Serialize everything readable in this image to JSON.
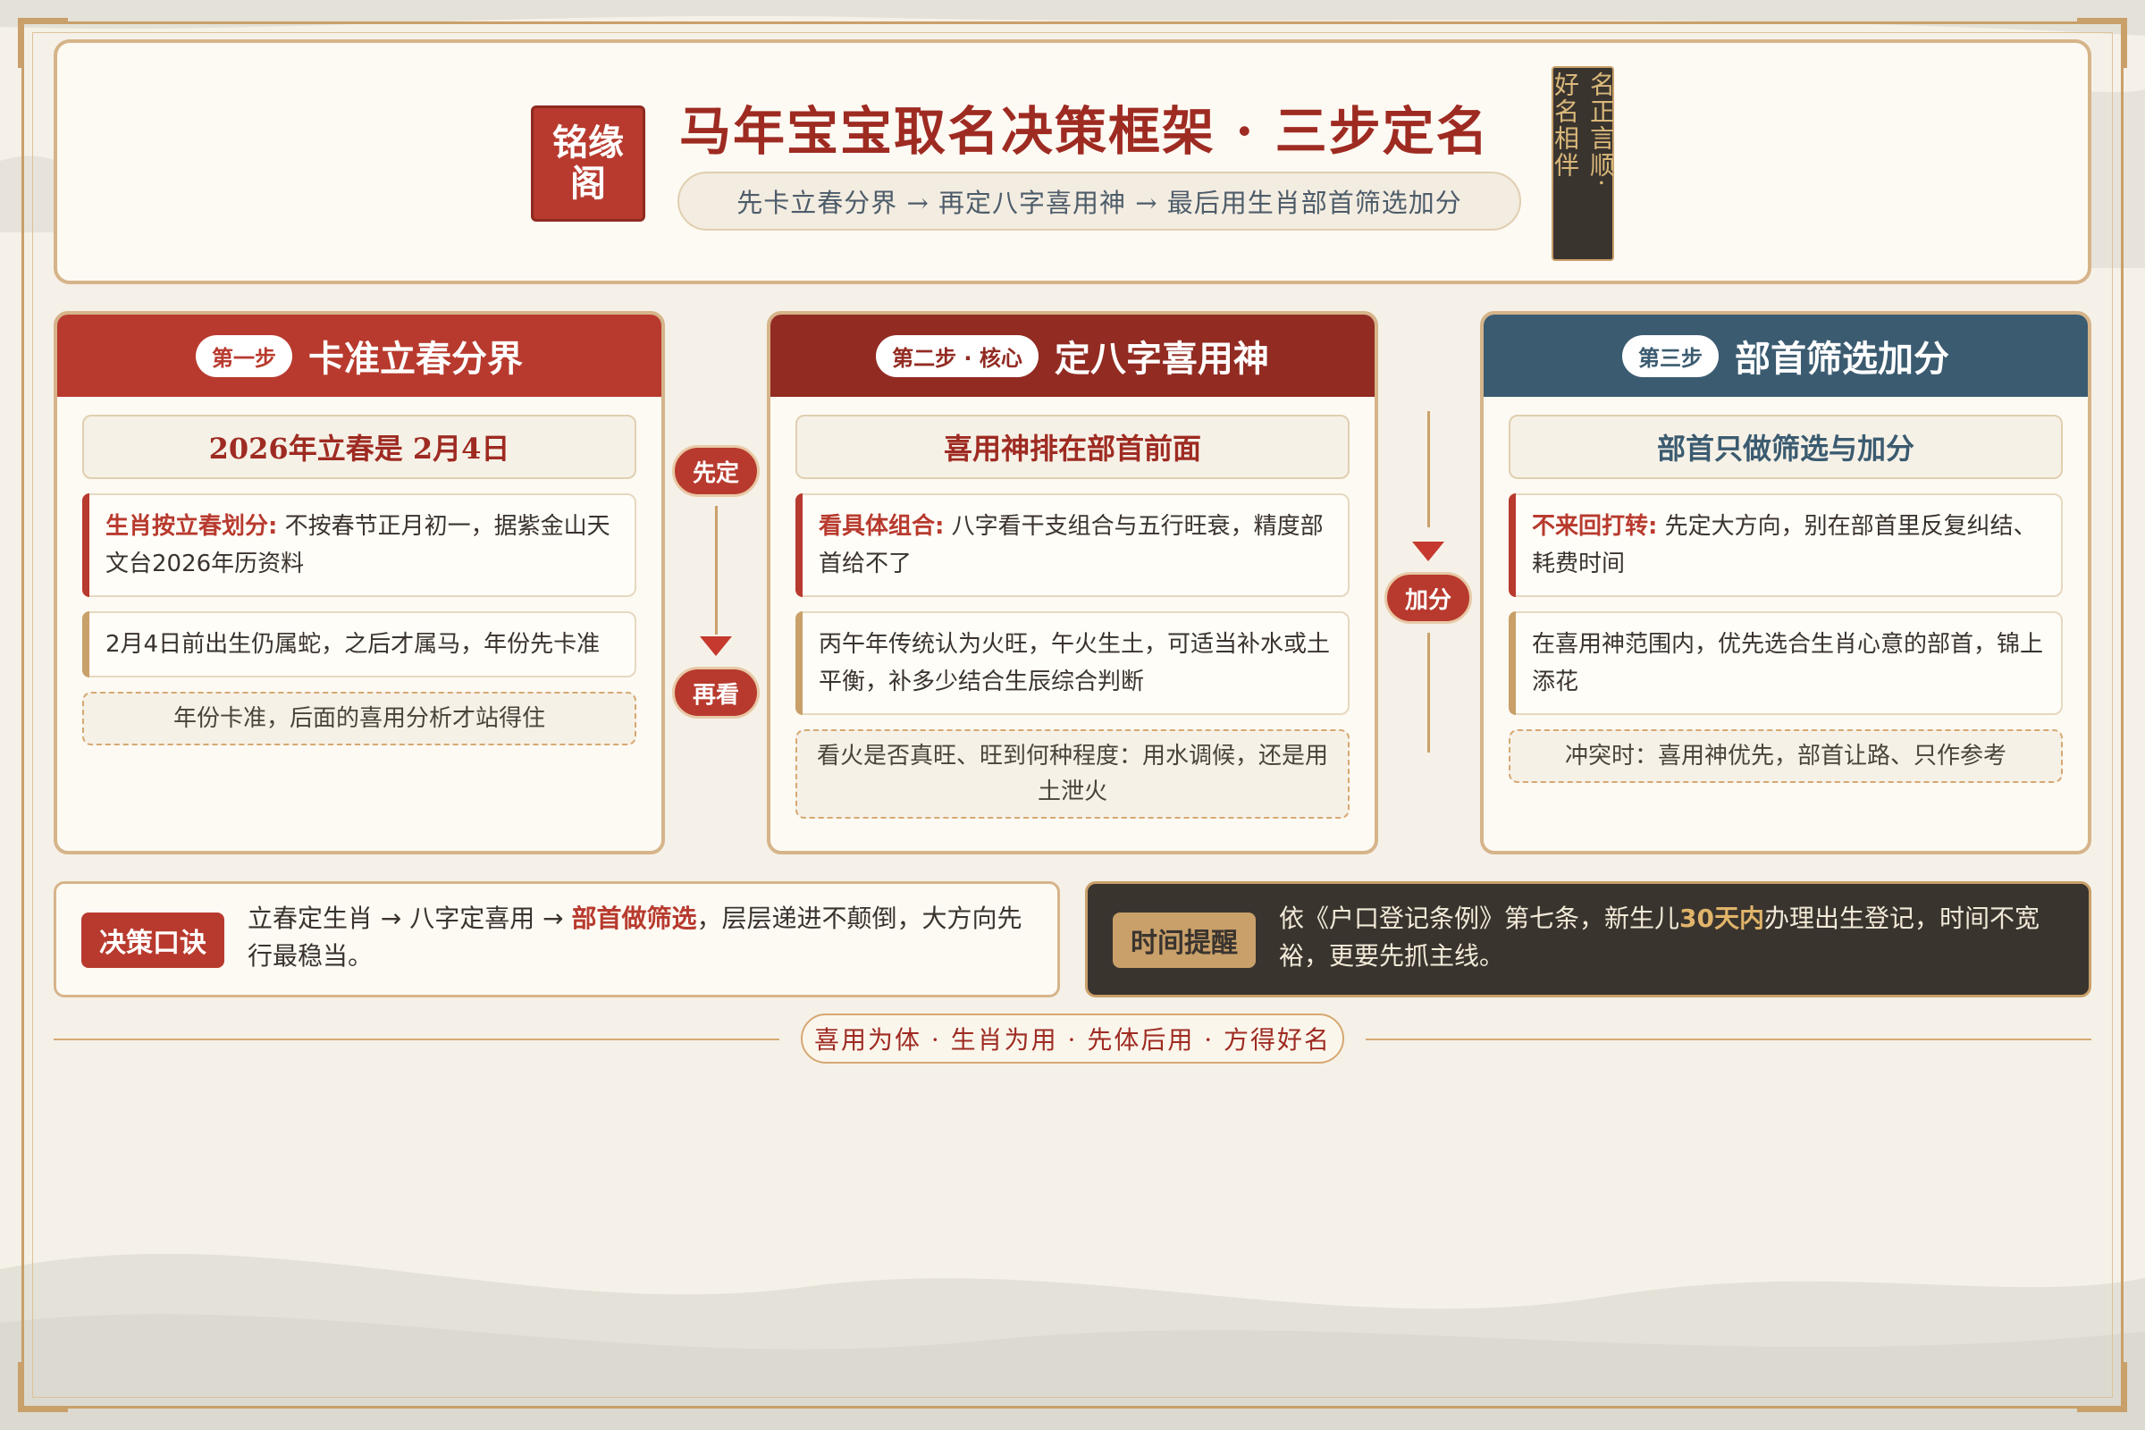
{
  "header": {
    "seal": "铭缘阁",
    "title": "马年宝宝取名决策框架 · 三步定名",
    "subtitle": "先卡立春分界 → 再定八字喜用神 → 最后用生肖部首筛选加分",
    "plaque_col1": "名正言顺·",
    "plaque_col2": "好名相伴"
  },
  "steps": [
    {
      "tag": "第一步",
      "title": "卡准立春分界",
      "subhead": "2026年立春是 2月4日",
      "item1_lead": "生肖按立春划分:",
      "item1_text": "不按春节正月初一，据紫金山天文台2026年历资料",
      "item2_text": "2月4日前出生仍属蛇，之后才属马，年份先卡准",
      "note": "年份卡准，后面的喜用分析才站得住"
    },
    {
      "tag": "第二步 · 核心",
      "title": "定八字喜用神",
      "subhead": "喜用神排在部首前面",
      "item1_lead": "看具体组合:",
      "item1_text": "八字看干支组合与五行旺衰，精度部首给不了",
      "item2_text": "丙午年传统认为火旺，午火生土，可适当补水或土平衡，补多少结合生辰综合判断",
      "note": "看火是否真旺、旺到何种程度：用水调候，还是用土泄火"
    },
    {
      "tag": "第三步",
      "title": "部首筛选加分",
      "subhead": "部首只做筛选与加分",
      "item1_lead": "不来回打转:",
      "item1_text": "先定大方向，别在部首里反复纠结、耗费时间",
      "item2_text": "在喜用神范围内，优先选合生肖心意的部首，锦上添花",
      "note": "冲突时：喜用神优先，部首让路、只作参考"
    }
  ],
  "connectors": {
    "c1_top": "先定",
    "c1_bottom": "再看",
    "c2": "加分"
  },
  "tips": {
    "left_badge": "决策口诀",
    "left_pre": "立春定生肖 → 八字定喜用 → ",
    "left_hl": "部首做筛选",
    "left_post": "，层层递进不颠倒，大方向先行最稳当。",
    "right_badge": "时间提醒",
    "right_pre": "依《户口登记条例》第七条，新生儿",
    "right_hl": "30天内",
    "right_post": "办理出生登记，时间不宽裕，更要先抓主线。"
  },
  "motto": "喜用为体 · 生肖为用 · 先体后用 · 方得好名",
  "colors": {
    "primary_red": "#b83a2e",
    "dark_red": "#922b22",
    "slate_blue": "#3b5b70",
    "gold": "#c9a06a",
    "dark_panel": "#3a342f"
  }
}
